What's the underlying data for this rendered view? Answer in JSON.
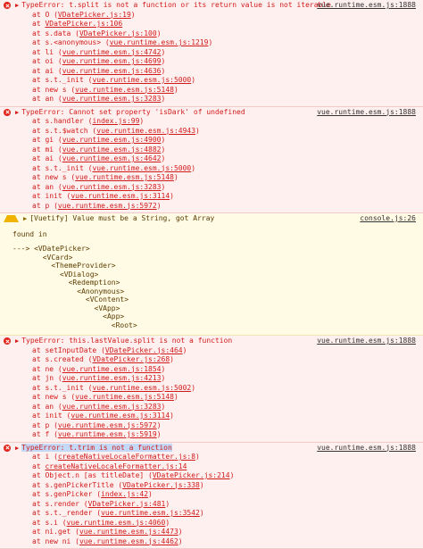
{
  "messages": [
    {
      "type": "error",
      "text": "TypeError: t.split is not a function or its return value is not iterable",
      "source": "vue.runtime.esm.js:1888",
      "frames": [
        {
          "pre": "at O (",
          "link": "VDatePicker.js:19",
          "post": ")"
        },
        {
          "pre": "at ",
          "link": "VDatePicker.js:106",
          "post": ""
        },
        {
          "pre": "at s.data (",
          "link": "VDatePicker.js:100",
          "post": ")"
        },
        {
          "pre": "at s.<anonymous> (",
          "link": "vue.runtime.esm.js:1219",
          "post": ")"
        },
        {
          "pre": "at li (",
          "link": "vue.runtime.esm.js:4742",
          "post": ")"
        },
        {
          "pre": "at oi (",
          "link": "vue.runtime.esm.js:4699",
          "post": ")"
        },
        {
          "pre": "at ai (",
          "link": "vue.runtime.esm.js:4636",
          "post": ")"
        },
        {
          "pre": "at s.t._init (",
          "link": "vue.runtime.esm.js:5000",
          "post": ")"
        },
        {
          "pre": "at new s (",
          "link": "vue.runtime.esm.js:5148",
          "post": ")"
        },
        {
          "pre": "at an (",
          "link": "vue.runtime.esm.js:3283",
          "post": ")"
        }
      ]
    },
    {
      "type": "error",
      "text": "TypeError: Cannot set property 'isDark' of undefined",
      "source": "vue.runtime.esm.js:1888",
      "frames": [
        {
          "pre": "at s.handler (",
          "link": "index.js:99",
          "post": ")"
        },
        {
          "pre": "at s.t.$watch (",
          "link": "vue.runtime.esm.js:4943",
          "post": ")"
        },
        {
          "pre": "at gi (",
          "link": "vue.runtime.esm.js:4900",
          "post": ")"
        },
        {
          "pre": "at mi (",
          "link": "vue.runtime.esm.js:4882",
          "post": ")"
        },
        {
          "pre": "at ai (",
          "link": "vue.runtime.esm.js:4642",
          "post": ")"
        },
        {
          "pre": "at s.t._init (",
          "link": "vue.runtime.esm.js:5000",
          "post": ")"
        },
        {
          "pre": "at new s (",
          "link": "vue.runtime.esm.js:5148",
          "post": ")"
        },
        {
          "pre": "at an (",
          "link": "vue.runtime.esm.js:3283",
          "post": ")"
        },
        {
          "pre": "at init (",
          "link": "vue.runtime.esm.js:3114",
          "post": ")"
        },
        {
          "pre": "at p (",
          "link": "vue.runtime.esm.js:5972",
          "post": ")"
        }
      ]
    },
    {
      "type": "warn",
      "text": "[Vuetify] Value must be a String, got Array",
      "source": "console.js:26",
      "found_in": "found in",
      "tree": [
        "---> <VDatePicker>",
        "       <VCard>",
        "         <ThemeProvider>",
        "           <VDialog>",
        "             <Redemption>",
        "               <Anonymous>",
        "                 <VContent>",
        "                   <VApp>",
        "                     <App>",
        "                       <Root>"
      ]
    },
    {
      "type": "error",
      "text": "TypeError: this.lastValue.split is not a function",
      "source": "vue.runtime.esm.js:1888",
      "frames": [
        {
          "pre": "at setInputDate (",
          "link": "VDatePicker.js:464",
          "post": ")"
        },
        {
          "pre": "at s.created (",
          "link": "VDatePicker.js:268",
          "post": ")"
        },
        {
          "pre": "at ne (",
          "link": "vue.runtime.esm.js:1854",
          "post": ")"
        },
        {
          "pre": "at jn (",
          "link": "vue.runtime.esm.js:4213",
          "post": ")"
        },
        {
          "pre": "at s.t._init (",
          "link": "vue.runtime.esm.js:5002",
          "post": ")"
        },
        {
          "pre": "at new s (",
          "link": "vue.runtime.esm.js:5148",
          "post": ")"
        },
        {
          "pre": "at an (",
          "link": "vue.runtime.esm.js:3283",
          "post": ")"
        },
        {
          "pre": "at init (",
          "link": "vue.runtime.esm.js:3114",
          "post": ")"
        },
        {
          "pre": "at p (",
          "link": "vue.runtime.esm.js:5972",
          "post": ")"
        },
        {
          "pre": "at f (",
          "link": "vue.runtime.esm.js:5919",
          "post": ")"
        }
      ]
    },
    {
      "type": "error",
      "text": "TypeError: t.trim is not a function",
      "source": "vue.runtime.esm.js:1888",
      "highlight": true,
      "frames": [
        {
          "pre": "at i (",
          "link": "createNativeLocaleFormatter.js:8",
          "post": ")"
        },
        {
          "pre": "at ",
          "link": "createNativeLocaleFormatter.js:14",
          "post": ""
        },
        {
          "pre": "at Object.n [as titleDate] (",
          "link": "VDatePicker.js:214",
          "post": ")"
        },
        {
          "pre": "at s.genPickerTitle (",
          "link": "VDatePicker.js:338",
          "post": ")"
        },
        {
          "pre": "at s.genPicker (",
          "link": "index.js:42",
          "post": ")"
        },
        {
          "pre": "at s.render (",
          "link": "VDatePicker.js:481",
          "post": ")"
        },
        {
          "pre": "at s.t._render (",
          "link": "vue.runtime.esm.js:3542",
          "post": ")"
        },
        {
          "pre": "at s.i (",
          "link": "vue.runtime.esm.js:4060",
          "post": ")"
        },
        {
          "pre": "at ni.get (",
          "link": "vue.runtime.esm.js:4473",
          "post": ")"
        },
        {
          "pre": "at new ni (",
          "link": "vue.runtime.esm.js:4462",
          "post": ")"
        }
      ]
    }
  ],
  "icons": {
    "error": "error-circle-icon",
    "warn": "warning-triangle-icon",
    "expand": "expand-caret-icon"
  },
  "colors": {
    "error_bg": "#fff0f0",
    "error_text": "#d11b1b",
    "warn_bg": "#fffbe5",
    "warn_text": "#5c3c00"
  }
}
